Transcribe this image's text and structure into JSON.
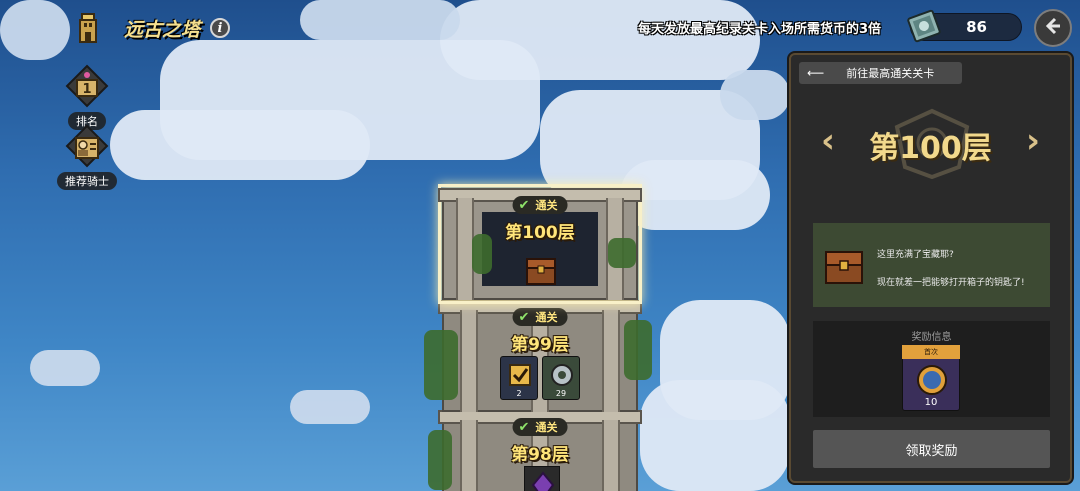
{
  "header": {
    "title": "远古之塔",
    "info_icon_label": "i",
    "currency_note": "每天发放最高纪录关卡入场所需货币的3倍",
    "currency_value": "86"
  },
  "side_menu": {
    "rank_label": "排名",
    "rank_badge": "1",
    "knights_label": "推荐骑士"
  },
  "tower": {
    "floors": [
      {
        "cleared_label": "通关",
        "label": "第100层"
      },
      {
        "cleared_label": "通关",
        "label": "第99层",
        "items": [
          {
            "count": "2"
          },
          {
            "count": "29"
          }
        ]
      },
      {
        "cleared_label": "通关",
        "label": "第98层"
      }
    ]
  },
  "panel": {
    "goto_label": "前往最高通关关卡",
    "floor_title": "第100层",
    "description_line1": "这里充满了宝藏耶?",
    "description_line2": "现在就差一把能够打开箱子的钥匙了!",
    "reward_header": "奖励信息",
    "reward_tag": "首次",
    "reward_count": "10",
    "claim_label": "领取奖励"
  },
  "colors": {
    "title_gold": "#f6e08f",
    "floor_label_gold": "#ffe57a",
    "panel_bg": "#2a2a2a",
    "desc_bg": "#3d4a33",
    "claim_btn": "#555555"
  }
}
